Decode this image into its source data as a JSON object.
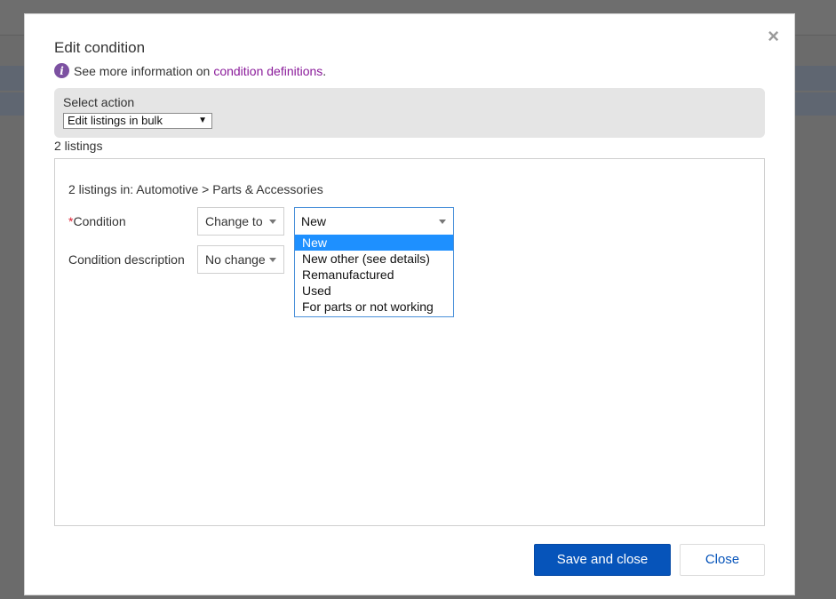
{
  "dialog": {
    "title": "Edit condition",
    "info_text": "See more information on",
    "info_link": "condition definitions",
    "info_suffix": ".",
    "close_glyph": "×"
  },
  "action": {
    "label": "Select action",
    "selected": "Edit listings in bulk",
    "arrow": "▼"
  },
  "listings_count": "2 listings",
  "category_path": "2 listings in: Automotive > Parts & Accessories",
  "condition_row": {
    "required_mark": "*",
    "label": "Condition",
    "mode": "Change to",
    "value": "New",
    "options": [
      "New",
      "New other (see details)",
      "Remanufactured",
      "Used",
      "For parts or not working"
    ],
    "highlighted_option": "New"
  },
  "description_row": {
    "label": "Condition description",
    "mode": "No change"
  },
  "buttons": {
    "save_label": "Save and close",
    "close_label": "Close"
  },
  "colors": {
    "primary": "#0654ba",
    "link": "#8a1b9a",
    "highlight": "#1e90ff",
    "required": "#dd1e31"
  },
  "icons": [
    "info-icon",
    "close-icon",
    "chevron-down-icon"
  ]
}
